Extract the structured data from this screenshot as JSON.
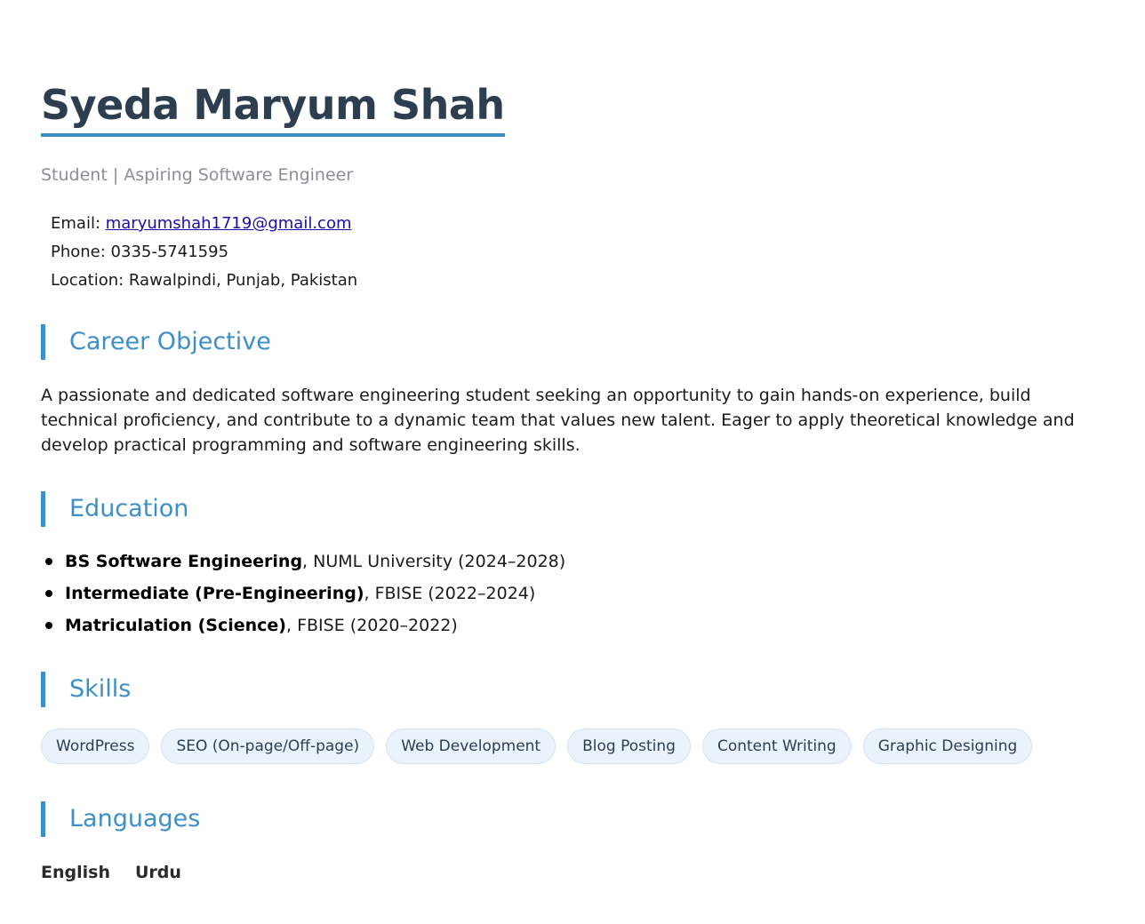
{
  "header": {
    "name": "Syeda Maryum Shah",
    "subtitle": "Student | Aspiring Software Engineer"
  },
  "contact": {
    "email_label": "Email: ",
    "email": "maryumshah1719@gmail.com",
    "phone_label": "Phone: ",
    "phone": "0335-5741595",
    "location_label": "Location: ",
    "location": "Rawalpindi, Punjab, Pakistan"
  },
  "objective": {
    "heading": "Career Objective",
    "text": "A passionate and dedicated software engineering student seeking an opportunity to gain hands-on experience, build technical proficiency, and contribute to a dynamic team that values new talent. Eager to apply theoretical knowledge and develop practical programming and software engineering skills."
  },
  "education": {
    "heading": "Education",
    "items": [
      {
        "degree": "BS Software Engineering",
        "detail": ", NUML University (2024–2028)"
      },
      {
        "degree": "Intermediate (Pre-Engineering)",
        "detail": ", FBISE (2022–2024)"
      },
      {
        "degree": "Matriculation (Science)",
        "detail": ", FBISE (2020–2022)"
      }
    ]
  },
  "skills": {
    "heading": "Skills",
    "items": [
      "WordPress",
      "SEO (On-page/Off-page)",
      "Web Development",
      "Blog Posting",
      "Content Writing",
      "Graphic Designing"
    ]
  },
  "languages": {
    "heading": "Languages",
    "items": [
      "English",
      "Urdu"
    ]
  },
  "colors": {
    "accent": "#3d8fc8",
    "name_text": "#2c3e50",
    "subtitle_text": "#8a8f94",
    "pill_bg": "#eaf2fc",
    "link": "#1a0dab"
  }
}
